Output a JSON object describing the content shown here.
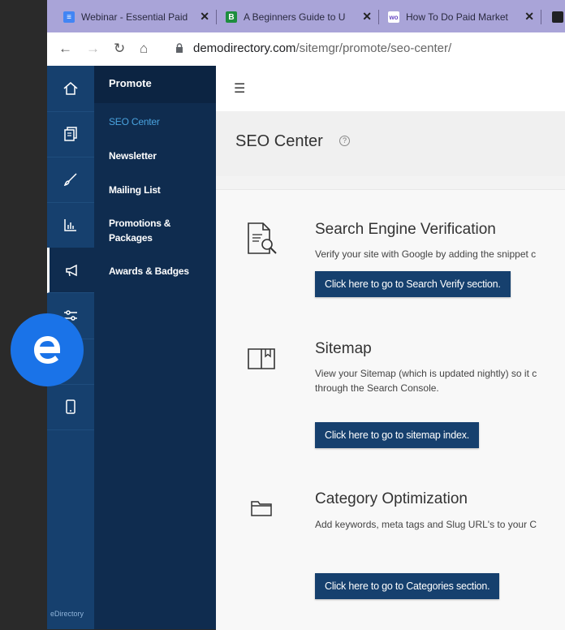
{
  "browser": {
    "tabs": [
      {
        "title": "Webinar - Essential Paid",
        "icon": "google-docs-icon",
        "color": "#4285f4"
      },
      {
        "title": "A Beginners Guide to U",
        "icon": "green-b-icon",
        "color": "#1e8e3e"
      },
      {
        "title": "How To Do Paid Market",
        "icon": "webinar-icon",
        "color": "#6a4bc4"
      }
    ],
    "url_domain": "demodirectory.com",
    "url_path": "/sitemgr/promote/seo-center/"
  },
  "rail": {
    "brand": "eDirectory"
  },
  "subnav": {
    "heading": "Promote",
    "items": [
      {
        "label": "SEO Center"
      },
      {
        "label": "Newsletter"
      },
      {
        "label": "Mailing List"
      },
      {
        "label": "Promotions & Packages"
      },
      {
        "label": "Awards & Badges"
      }
    ]
  },
  "page": {
    "title": "SEO Center",
    "help": "?"
  },
  "sections": [
    {
      "title": "Search Engine Verification",
      "desc": "Verify your site with Google by adding the snippet c",
      "button": "Click here to go to Search Verify section.",
      "icon": "document-search-icon"
    },
    {
      "title": "Sitemap",
      "desc": "View your Sitemap (which is updated nightly) so it c",
      "desc2": "through the Search Console.",
      "button": "Click here to go to sitemap index.",
      "icon": "book-bookmark-icon"
    },
    {
      "title": "Category Optimization",
      "desc": "Add keywords, meta tags and Slug URL's to your C",
      "button": "Click here to go to Categories section.",
      "icon": "folder-icon"
    }
  ],
  "colors": {
    "rail": "#16406e",
    "subnav": "#0f2c4f",
    "accent": "#4aa3df",
    "button": "#16406e",
    "logo": "#1a73e8"
  }
}
